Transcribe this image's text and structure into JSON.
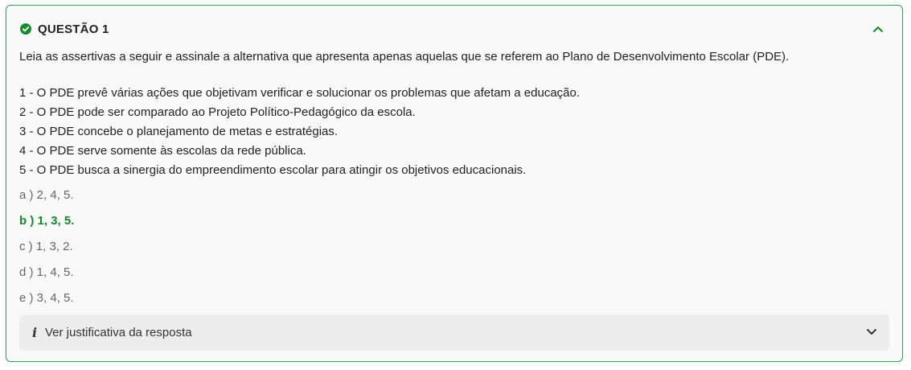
{
  "question": {
    "title": "QUESTÃO 1",
    "status_icon": "check-circle-icon",
    "statement": "Leia as assertivas a seguir e assinale a alternativa que apresenta apenas aquelas que se referem ao Plano de Desenvolvimento Escolar (PDE).",
    "assertions": [
      "1 - O PDE prevê várias ações que objetivam verificar e solucionar os problemas que afetam a educação.",
      "2 - O PDE pode ser comparado ao Projeto Político-Pedagógico da escola.",
      "3 - O PDE concebe o planejamento de metas e estratégias.",
      "4 - O PDE serve somente às escolas da rede pública.",
      "5 - O PDE busca a sinergia do empreendimento escolar para atingir os objetivos educacionais."
    ],
    "options": [
      {
        "label": "a ) 2, 4, 5.",
        "correct": false
      },
      {
        "label": "b ) 1, 3, 5.",
        "correct": true
      },
      {
        "label": "c ) 1, 3, 2.",
        "correct": false
      },
      {
        "label": "d ) 1, 4, 5.",
        "correct": false
      },
      {
        "label": "e ) 3, 4, 5.",
        "correct": false
      }
    ],
    "justification": {
      "icon_glyph": "i",
      "label": "Ver justificativa da resposta"
    }
  },
  "colors": {
    "accent": "#2e9e4f",
    "correct_text": "#138a2c",
    "option_text": "#666666",
    "panel_bg": "#ededed"
  }
}
